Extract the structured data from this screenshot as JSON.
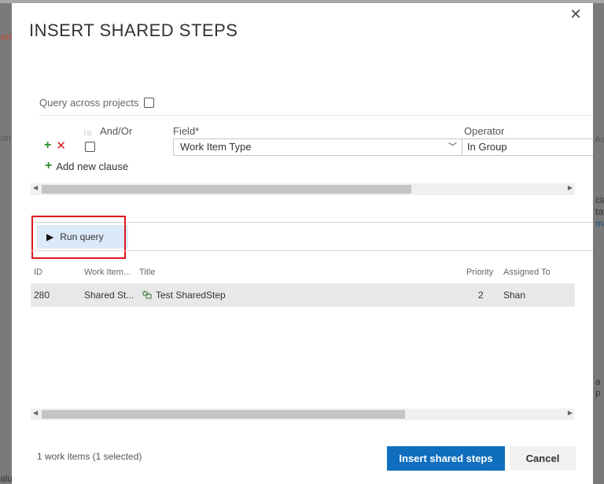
{
  "background": {
    "left_fragment_1": "temp",
    "left_fragment_2": "ion",
    "right_fragment_1": "Ass",
    "right_fragment_2": "ciat",
    "right_fragment_3": "tat",
    "right_fragment_4": "mc",
    "right_fragment_5": "a p",
    "bottom_fragment": "alu"
  },
  "dialog": {
    "title": "INSERT SHARED STEPS",
    "close_glyph": "✕"
  },
  "query": {
    "across_projects_label": "Query across projects",
    "across_projects_checked": false,
    "headers": {
      "andor": "And/Or",
      "field": "Field*",
      "operator": "Operator"
    },
    "clause": {
      "field_value": "Work Item Type",
      "operator_value": "In Group"
    },
    "add_clause_label": "Add new clause",
    "run_query_label": "Run query"
  },
  "results": {
    "columns": [
      "ID",
      "Work Item...",
      "Title",
      "Priority",
      "Assigned To"
    ],
    "rows": [
      {
        "id": "280",
        "type": "Shared St...",
        "title": "Test SharedStep",
        "priority": "2",
        "assigned_to": "Shan"
      }
    ]
  },
  "footer": {
    "count_text": "1 work items (1 selected)",
    "insert_label": "Insert shared steps",
    "cancel_label": "Cancel"
  },
  "colors": {
    "primary": "#106ebe",
    "highlight_box": "#e0161b",
    "add_green": "#2f8a2a",
    "remove_red": "#d12020"
  }
}
